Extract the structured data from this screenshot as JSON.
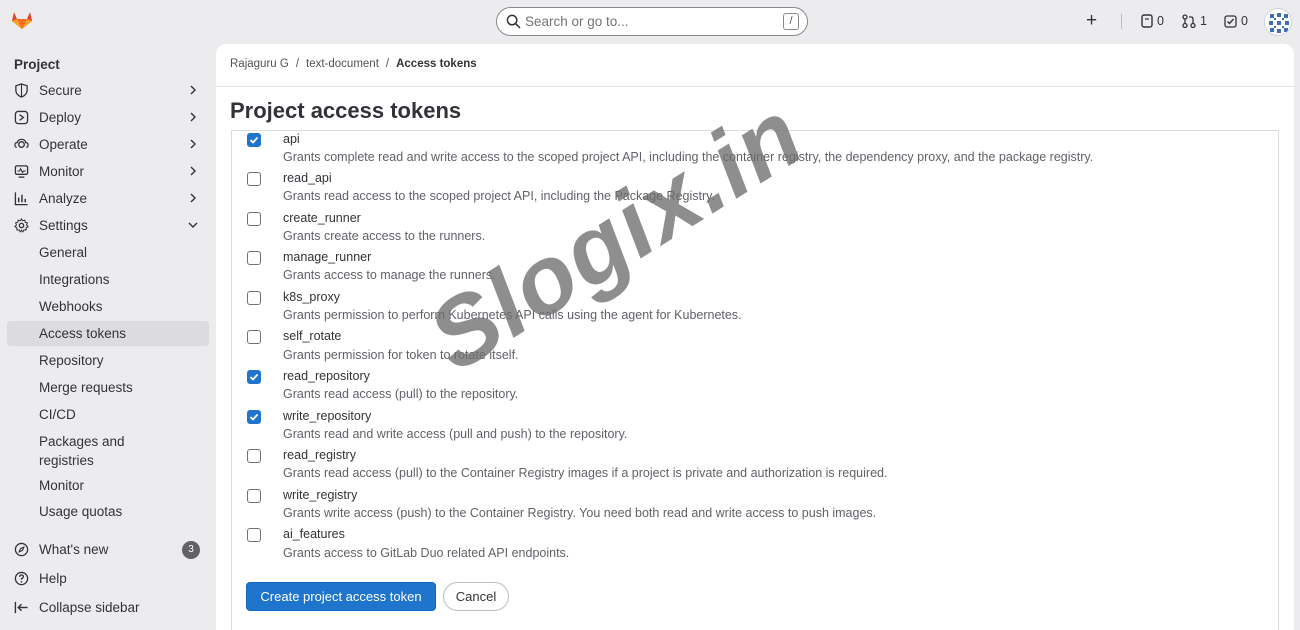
{
  "topbar": {
    "search_placeholder": "Search or go to...",
    "search_shortcut": "/",
    "issues_count": "0",
    "merge_requests_count": "1",
    "todos_count": "0"
  },
  "sidebar": {
    "context": "Project",
    "items": [
      {
        "label": "Secure"
      },
      {
        "label": "Deploy"
      },
      {
        "label": "Operate"
      },
      {
        "label": "Monitor"
      },
      {
        "label": "Analyze"
      },
      {
        "label": "Settings"
      }
    ],
    "settings_sub": [
      {
        "label": "General"
      },
      {
        "label": "Integrations"
      },
      {
        "label": "Webhooks"
      },
      {
        "label": "Access tokens"
      },
      {
        "label": "Repository"
      },
      {
        "label": "Merge requests"
      },
      {
        "label": "CI/CD"
      },
      {
        "label": "Packages and registries"
      },
      {
        "label": "Monitor"
      },
      {
        "label": "Usage quotas"
      }
    ],
    "whats_new": "What's new",
    "whats_new_count": "3",
    "help": "Help",
    "collapse": "Collapse sidebar"
  },
  "breadcrumb": [
    "Rajaguru G",
    "text-document",
    "Access tokens"
  ],
  "page_title": "Project access tokens",
  "scopes": [
    {
      "name": "api",
      "checked": true,
      "desc": "Grants complete read and write access to the scoped project API, including the container registry, the dependency proxy, and the package registry."
    },
    {
      "name": "read_api",
      "checked": false,
      "desc": "Grants read access to the scoped project API, including the Package Registry."
    },
    {
      "name": "create_runner",
      "checked": false,
      "desc": "Grants create access to the runners."
    },
    {
      "name": "manage_runner",
      "checked": false,
      "desc": "Grants access to manage the runners."
    },
    {
      "name": "k8s_proxy",
      "checked": false,
      "desc": "Grants permission to perform Kubernetes API calls using the agent for Kubernetes."
    },
    {
      "name": "self_rotate",
      "checked": false,
      "desc": "Grants permission for token to rotate itself."
    },
    {
      "name": "read_repository",
      "checked": true,
      "desc": "Grants read access (pull) to the repository."
    },
    {
      "name": "write_repository",
      "checked": true,
      "desc": "Grants read and write access (pull and push) to the repository."
    },
    {
      "name": "read_registry",
      "checked": false,
      "desc": "Grants read access (pull) to the Container Registry images if a project is private and authorization is required."
    },
    {
      "name": "write_registry",
      "checked": false,
      "desc": "Grants write access (push) to the Container Registry. You need both read and write access to push images."
    },
    {
      "name": "ai_features",
      "checked": false,
      "desc": "Grants access to GitLab Duo related API endpoints."
    }
  ],
  "buttons": {
    "create": "Create project access token",
    "cancel": "Cancel"
  },
  "watermark": "Slogix.in",
  "colors": {
    "primary": "#1f75cb",
    "sidebar_bg": "#ececef",
    "active_item": "#dcdcde"
  }
}
